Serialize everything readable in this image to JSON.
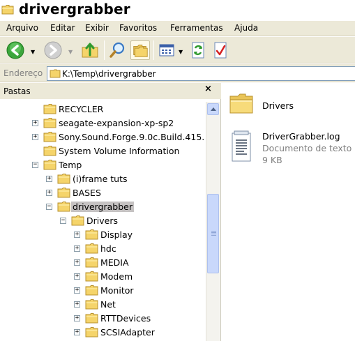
{
  "window": {
    "title": "drivergrabber"
  },
  "menu": [
    "Arquivo",
    "Editar",
    "Exibir",
    "Favoritos",
    "Ferramentas",
    "Ajuda"
  ],
  "toolbar": {
    "back": "back-icon",
    "forward": "forward-icon",
    "up": "folder-up-icon",
    "search": "search-icon",
    "folders": "folders-icon",
    "views": "views-icon",
    "sync": "sync-icon",
    "tasks": "checklist-icon"
  },
  "address": {
    "label": "Endereço",
    "path": "K:\\Temp\\drivergrabber"
  },
  "folders_pane": {
    "title": "Pastas",
    "close": "×",
    "tree": [
      {
        "label": "RECYCLER",
        "expander": ""
      },
      {
        "label": "seagate-expansion-xp-sp2",
        "expander": "+"
      },
      {
        "label": "Sony.Sound.Forge.9.0c.Build.415.",
        "expander": "+"
      },
      {
        "label": "System Volume Information",
        "expander": ""
      },
      {
        "label": "Temp",
        "expander": "−"
      },
      {
        "label": "(i)frame tuts",
        "expander": "+"
      },
      {
        "label": "BASES",
        "expander": "+"
      },
      {
        "label": "drivergrabber",
        "expander": "−"
      },
      {
        "label": "Drivers",
        "expander": "−"
      },
      {
        "label": "Display",
        "expander": "+"
      },
      {
        "label": "hdc",
        "expander": "+"
      },
      {
        "label": "MEDIA",
        "expander": "+"
      },
      {
        "label": "Modem",
        "expander": "+"
      },
      {
        "label": "Monitor",
        "expander": "+"
      },
      {
        "label": "Net",
        "expander": "+"
      },
      {
        "label": "RTTDevices",
        "expander": "+"
      },
      {
        "label": "SCSIAdapter",
        "expander": "+"
      }
    ]
  },
  "files": [
    {
      "name": "Drivers",
      "icon": "folder-icon"
    },
    {
      "name": "DriverGrabber.log",
      "type": "Documento de texto",
      "size": "9 KB",
      "icon": "text-document-icon"
    }
  ],
  "colors": {
    "chrome": "#ece9d8",
    "selection": "#c5c2c2",
    "folder": "#f3d36b"
  }
}
